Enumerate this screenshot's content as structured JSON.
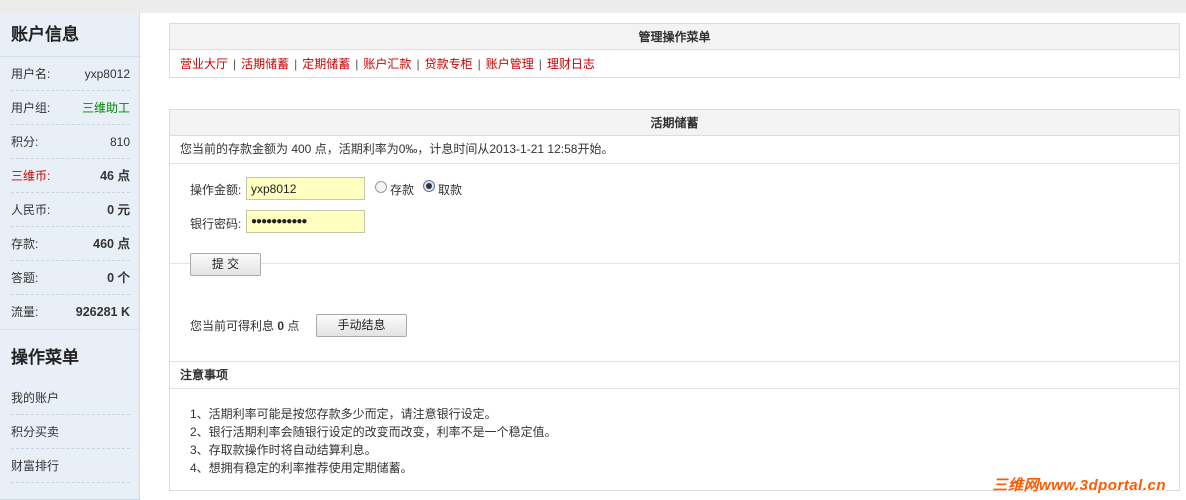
{
  "sidebar": {
    "account_title": "账户信息",
    "info": [
      {
        "label": "用户名:",
        "value": "yxp8012",
        "style": "normal",
        "label_style": "normal"
      },
      {
        "label": "用户组:",
        "value": "三维助工",
        "style": "green",
        "label_style": "normal"
      },
      {
        "label": "积分:",
        "value": "810",
        "style": "normal",
        "label_style": "normal"
      },
      {
        "label": "三维币:",
        "value": "46 点",
        "style": "bold",
        "label_style": "red"
      },
      {
        "label": "人民币:",
        "value": "0 元",
        "style": "bold",
        "label_style": "normal"
      },
      {
        "label": "存款:",
        "value": "460 点",
        "style": "bold",
        "label_style": "normal"
      },
      {
        "label": "答题:",
        "value": "0 个",
        "style": "bold",
        "label_style": "normal"
      },
      {
        "label": "流量:",
        "value": "926281 K",
        "style": "bold",
        "label_style": "normal"
      }
    ],
    "menu_title": "操作菜单",
    "menu": [
      "我的账户",
      "积分买卖",
      "财富排行"
    ]
  },
  "manage_panel": {
    "title": "管理操作菜单",
    "links": [
      "营业大厅",
      "活期储蓄",
      "定期储蓄",
      "账户汇款",
      "贷款专柜",
      "账户管理",
      "理财日志"
    ],
    "separator": "|"
  },
  "savings_panel": {
    "title": "活期储蓄",
    "description": "您当前的存款金额为 400 点，活期利率为0‰，计息时间从2013-1-21 12:58开始。",
    "amount_label": "操作金额:",
    "amount_value": "yxp8012",
    "password_label": "银行密码:",
    "password_value": "●●●●●●●●●●●",
    "radio_deposit": "存款",
    "radio_withdraw": "取款",
    "selected_option": "取款",
    "submit_label": "提 交",
    "interest_prefix": "您当前可得利息",
    "interest_value": "0",
    "interest_unit": "点",
    "settle_button": "手动结息",
    "notice_title": "注意事项",
    "notices": [
      "1、活期利率可能是按您存款多少而定，请注意银行设定。",
      "2、银行活期利率会随银行设定的改变而改变，利率不是一个稳定值。",
      "3、存取款操作时将自动结算利息。",
      "4、想拥有稳定的利率推荐使用定期储蓄。"
    ]
  },
  "watermark": "三维网www.3dportal.cn",
  "colors": {
    "link_red": "#cc0000",
    "sidebar_bg": "#e8eff7",
    "input_bg": "#ffffc2",
    "group_green": "#008800",
    "watermark_orange": "#ff5a00"
  }
}
